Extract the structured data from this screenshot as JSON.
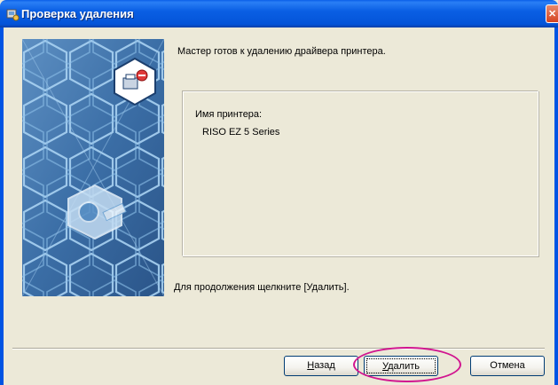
{
  "window": {
    "title": "Проверка удаления",
    "close_symbol": "✕",
    "colors": {
      "titlebar": "#0a5fe4",
      "face": "#ece9d8",
      "banner": "#2f5d92",
      "highlight": "#d1158f"
    }
  },
  "content": {
    "intro": "Мастер готов к удалению драйвера принтера.",
    "printer_label": "Имя принтера:",
    "printer_name": "RISO EZ 5 Series",
    "continue_text": "Для продолжения щелкните [Удалить]."
  },
  "buttons": {
    "back": {
      "accel": "Н",
      "rest": "азад"
    },
    "delete": {
      "accel": "У",
      "rest": "далить"
    },
    "cancel": "Отмена"
  },
  "icons": [
    "setup-icon",
    "close-icon",
    "printer-error-icon",
    "printer-icon"
  ]
}
